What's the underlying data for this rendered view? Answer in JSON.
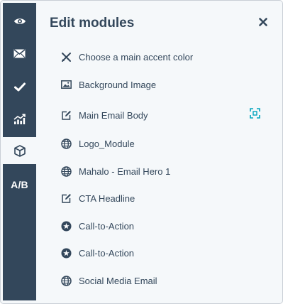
{
  "panel": {
    "title": "Edit modules",
    "close_icon": "close-icon"
  },
  "rail": {
    "items": [
      {
        "icon": "eye-icon",
        "active": false
      },
      {
        "icon": "envelope-icon",
        "active": false
      },
      {
        "icon": "checkmark-icon",
        "active": false
      },
      {
        "icon": "analytics-icon",
        "active": false
      },
      {
        "icon": "cube-icon",
        "active": true
      },
      {
        "label": "A/B",
        "active": false
      }
    ]
  },
  "modules": [
    {
      "label": "Choose a main accent color",
      "icon": "color-picker-icon"
    },
    {
      "label": "Background Image",
      "icon": "image-icon"
    },
    {
      "label": "Main Email Body",
      "icon": "edit-icon",
      "has_hover_action": true,
      "hover_action_icon": "expand-icon"
    },
    {
      "label": "Logo_Module",
      "icon": "globe-icon"
    },
    {
      "label": "Mahalo - Email Hero 1",
      "icon": "globe-icon"
    },
    {
      "label": "CTA Headline",
      "icon": "edit-icon"
    },
    {
      "label": "Call-to-Action",
      "icon": "star-icon"
    },
    {
      "label": "Call-to-Action",
      "icon": "star-icon"
    },
    {
      "label": "Social Media Email",
      "icon": "globe-icon"
    }
  ],
  "colors": {
    "rail_bg": "#33475b",
    "panel_bg": "#f5f8fa",
    "text": "#33475b",
    "accent": "#00a4bd"
  }
}
